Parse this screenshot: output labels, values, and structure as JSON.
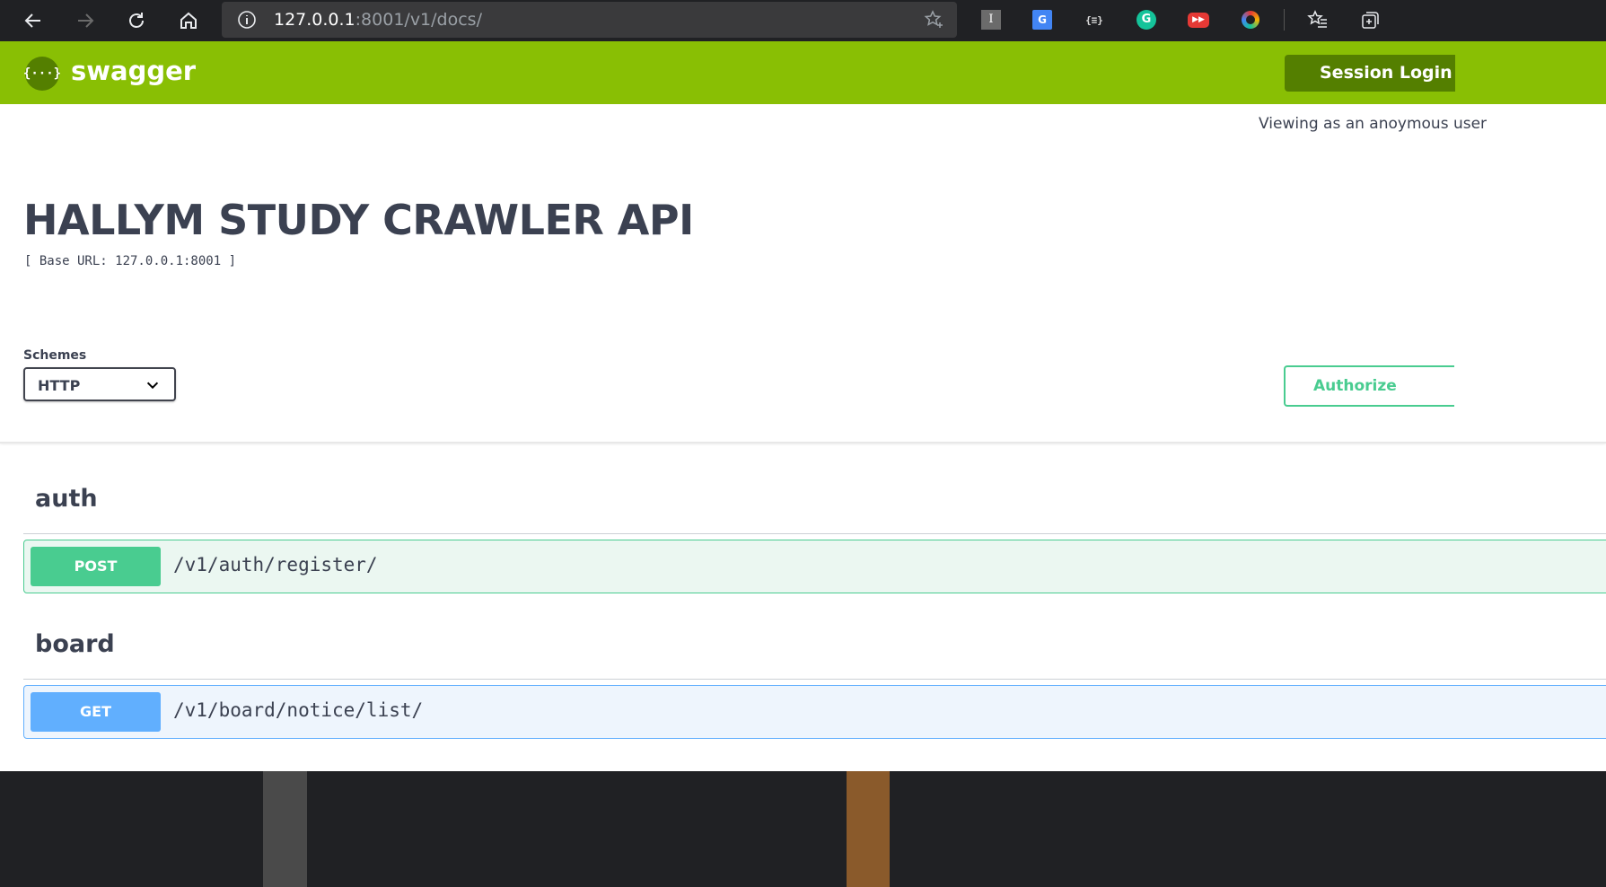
{
  "browser": {
    "url_host": "127.0.0.1",
    "url_rest": ":8001/v1/docs/",
    "icons": {
      "back": "back-arrow-icon",
      "forward": "forward-arrow-icon",
      "reload": "reload-icon",
      "home": "home-icon",
      "info": "info-icon",
      "favorite": "star-add-icon"
    },
    "extensions": [
      {
        "name": "instapaper-extension-icon",
        "glyph": "I",
        "bg": "#6b6b6b",
        "fg": "#ffffff"
      },
      {
        "name": "google-translate-extension-icon",
        "glyph": "G",
        "bg": "#4285f4",
        "fg": "#ffffff"
      },
      {
        "name": "json-viewer-extension-icon",
        "glyph": "{≡}",
        "bg": "#202124",
        "fg": "#dddddd"
      },
      {
        "name": "grammarly-extension-icon",
        "glyph": "G",
        "bg": "#15c39a",
        "fg": "#ffffff"
      },
      {
        "name": "video-speed-extension-icon",
        "glyph": "▸▸",
        "bg": "#e53935",
        "fg": "#ffffff"
      },
      {
        "name": "color-picker-extension-icon",
        "glyph": "◉",
        "bg": "#f4b400",
        "fg": "#3f51b5"
      }
    ]
  },
  "topbar": {
    "logo_glyph": "{···}",
    "logo_text": "swagger",
    "session_label": "Session Login"
  },
  "viewing_text": "Viewing as an anoymous user",
  "info": {
    "title": "HALLYM STUDY CRAWLER API",
    "base_url": "[ Base URL: 127.0.0.1:8001 ]"
  },
  "schemes": {
    "label": "Schemes",
    "selected": "HTTP"
  },
  "authorize_label": "Authorize",
  "tags": [
    {
      "name": "auth",
      "operations": [
        {
          "method": "POST",
          "path": "/v1/auth/register/"
        }
      ]
    },
    {
      "name": "board",
      "operations": [
        {
          "method": "GET",
          "path": "/v1/board/notice/list/"
        }
      ]
    }
  ],
  "colors": {
    "topbar": "#89bf04",
    "post": "#49cc90",
    "get": "#61affe",
    "text": "#3b4151"
  }
}
